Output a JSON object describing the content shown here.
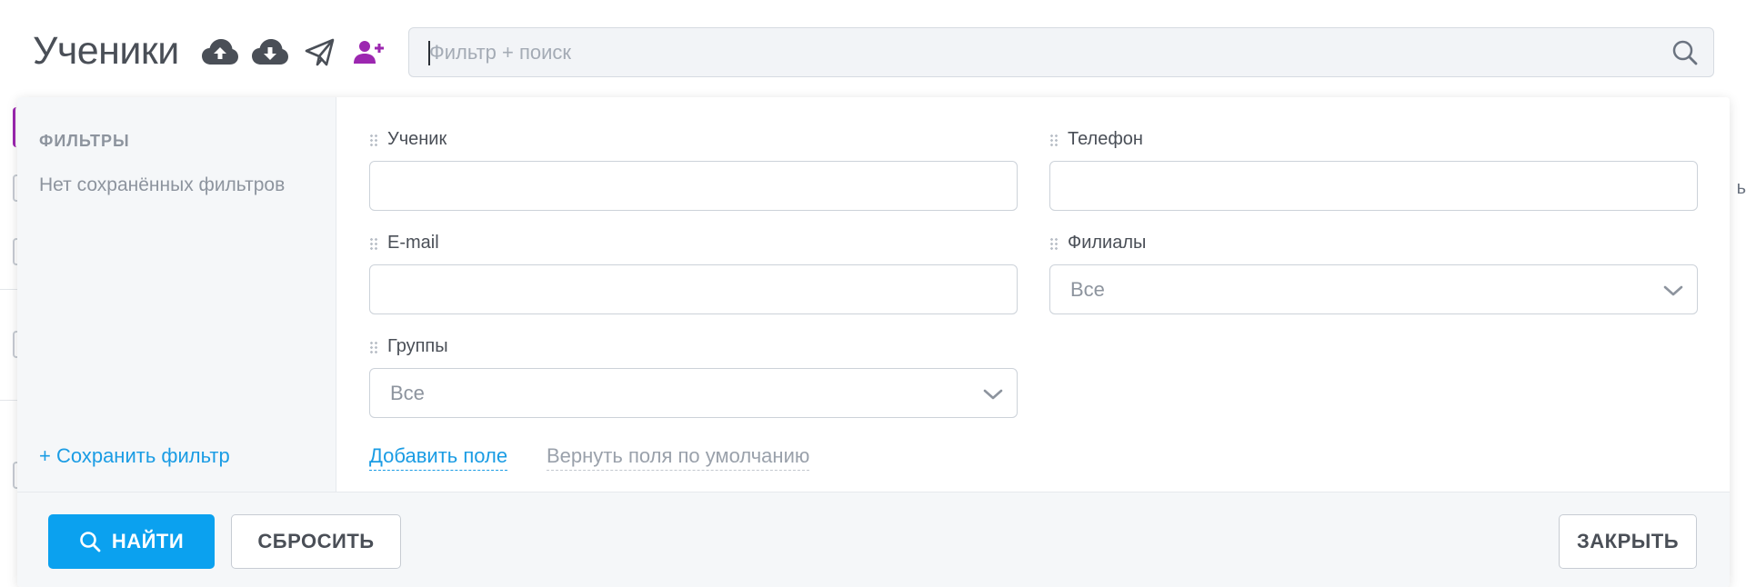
{
  "header": {
    "title": "Ученики",
    "icons": [
      "cloud-upload-icon",
      "cloud-download-icon",
      "paper-plane-icon",
      "add-user-icon"
    ],
    "search": {
      "placeholder": "Фильтр + поиск",
      "value": ""
    }
  },
  "colors": {
    "accent": "#0ba1ef",
    "link": "#1a9ce4",
    "add_user_icon": "#9c27b0",
    "muted_text": "#8d949e"
  },
  "filter_panel": {
    "sidebar": {
      "title": "ФИЛЬТРЫ",
      "empty_text": "Нет сохранённых фильтров",
      "save_link": "+ Сохранить фильтр"
    },
    "fields": {
      "student": {
        "label": "Ученик",
        "value": ""
      },
      "phone": {
        "label": "Телефон",
        "value": ""
      },
      "email": {
        "label": "E-mail",
        "value": ""
      },
      "branches": {
        "label": "Филиалы",
        "selected": "Все"
      },
      "groups": {
        "label": "Группы",
        "selected": "Все"
      }
    },
    "links": {
      "add_field": "Добавить поле",
      "reset_fields": "Вернуть поля по умолчанию"
    },
    "buttons": {
      "find": "НАЙТИ",
      "reset": "СБРОСИТЬ",
      "close": "ЗАКРЫТЬ"
    }
  },
  "background": {
    "cut_text": "ь"
  }
}
